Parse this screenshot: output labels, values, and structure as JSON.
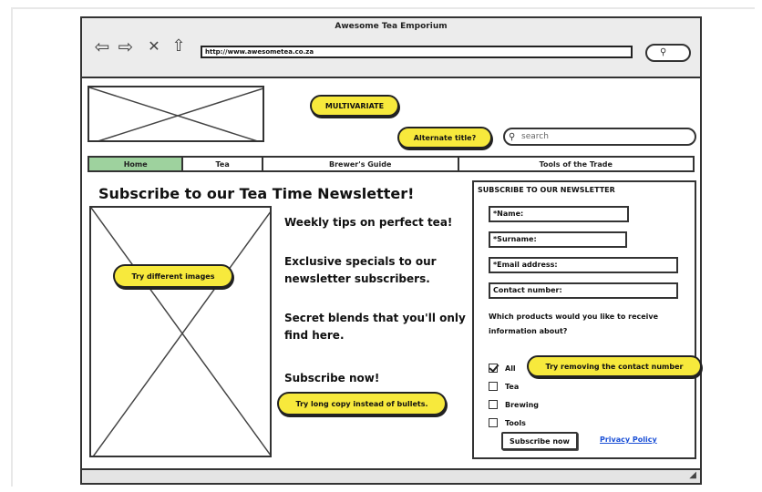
{
  "browser": {
    "title": "Awesome Tea Emporium",
    "url": "http://www.awesometea.co.za",
    "icons": [
      "back-arrow-icon",
      "forward-arrow-icon",
      "close-x-icon",
      "home-icon",
      "search-icon"
    ]
  },
  "header": {
    "search_placeholder": "search"
  },
  "nav": {
    "items": [
      "Home",
      "Tea",
      "Brewer's Guide",
      "Tools of the Trade"
    ],
    "active": "Home",
    "active_color": "#9ed29e"
  },
  "main": {
    "headline": "Subscribe to our Tea Time Newsletter!",
    "bullets": [
      "Weekly tips on perfect tea!",
      "Exclusive specials to our newsletter subscribers.",
      "Secret blends that you'll only find here.",
      "Subscribe now!"
    ]
  },
  "form": {
    "title": "SUBSCRIBE TO OUR NEWSLETTER",
    "fields": [
      "*Name:",
      "*Surname:",
      "*Email address:",
      "Contact number:"
    ],
    "question": "Which products would you like to receive information about?",
    "options": [
      {
        "label": "All",
        "checked": true
      },
      {
        "label": "Tea",
        "checked": false
      },
      {
        "label": "Brewing",
        "checked": false
      },
      {
        "label": "Tools",
        "checked": false
      }
    ],
    "submit_label": "Subscribe now",
    "privacy_label": "Privacy Policy",
    "link_color": "#1a4fd6"
  },
  "notes": {
    "multivariate": "MULTIVARIATE",
    "alternate_title": "Alternate title?",
    "different_images": "Try different images",
    "long_copy": "Try long copy instead of bullets.",
    "remove_contact": "Try removing the contact number",
    "note_color": "#f7e93c"
  }
}
